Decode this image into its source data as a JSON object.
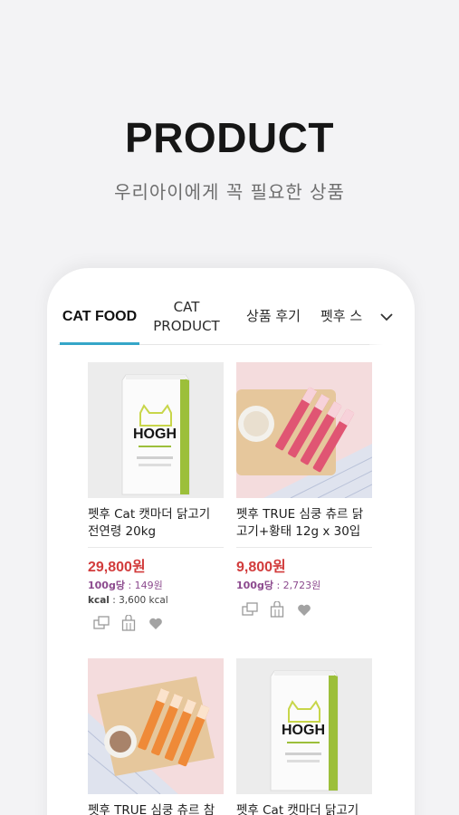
{
  "hero": {
    "title": "PRODUCT",
    "subtitle": "우리아이에게 꼭 필요한 상품"
  },
  "tabs": [
    {
      "label": "CAT FOOD",
      "active": true
    },
    {
      "label": "CAT\nPRODUCT",
      "active": false
    },
    {
      "label": "상품 후기",
      "active": false
    },
    {
      "label": "펫후 스",
      "active": false
    }
  ],
  "more_icon": "chevron-down-icon",
  "accent_color": "#35a6c8",
  "price_color": "#d23c3c",
  "products": [
    {
      "name": "펫후 Cat 캣마더 닭고기 전연령 20kg",
      "price": "29,800원",
      "unit_label": "100g당",
      "unit_price": "149원",
      "kcal_label": "kcal",
      "kcal_value": "3,600 kcal",
      "image": "food-bag",
      "bag_brand": "HOGH"
    },
    {
      "name": "펫후 TRUE 심쿵 츄르 닭고기+황태 12g x 30입",
      "price": "9,800원",
      "unit_label": "100g당",
      "unit_price": "2,723원",
      "image": "treat-sticks-pink"
    },
    {
      "name": "펫후 TRUE 심쿵 츄르 참",
      "image": "treat-sticks-orange"
    },
    {
      "name": "펫후 Cat 캣마더 닭고기",
      "image": "food-bag",
      "bag_brand": "HOGH"
    }
  ],
  "action_icons": [
    "compare-icon",
    "cart-icon",
    "heart-icon"
  ]
}
